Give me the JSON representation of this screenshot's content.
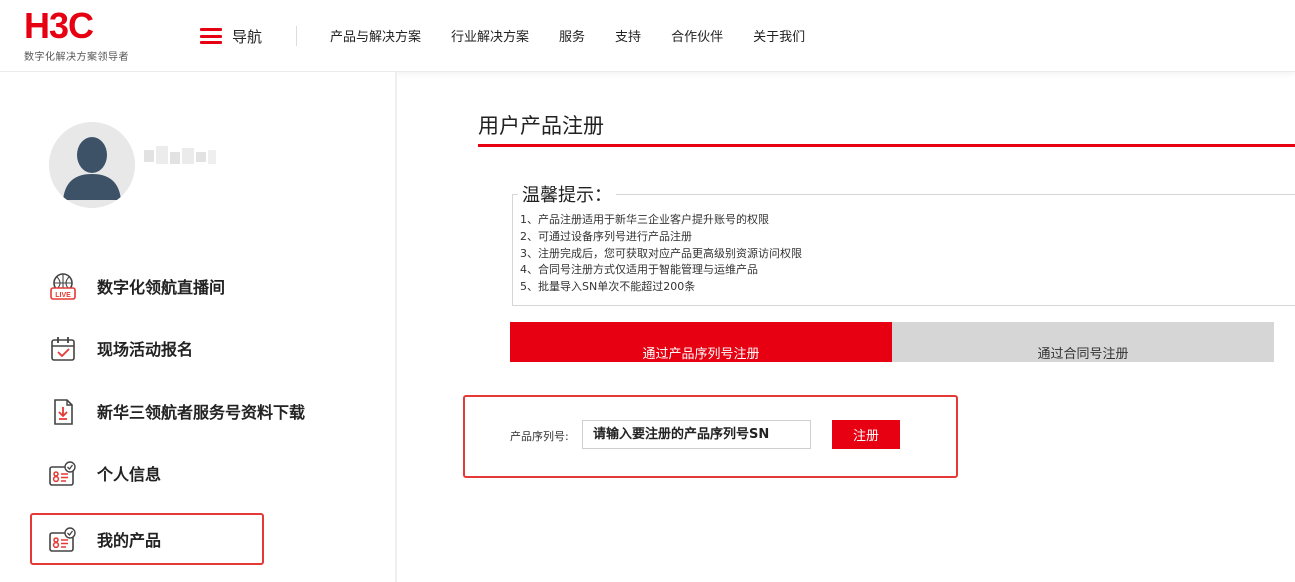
{
  "header": {
    "logo_text": "H3C",
    "logo_tagline": "数字化解决方案领导者",
    "nav_toggle_label": "导航",
    "nav_items": [
      "产品与解决方案",
      "行业解决方案",
      "服务",
      "支持",
      "合作伙伴",
      "关于我们"
    ]
  },
  "sidebar": {
    "menu": [
      {
        "label": "数字化领航直播间",
        "icon": "live-icon"
      },
      {
        "label": "现场活动报名",
        "icon": "calendar-icon"
      },
      {
        "label": "新华三领航者服务号资料下载",
        "icon": "download-doc-icon"
      },
      {
        "label": "个人信息",
        "icon": "id-card-icon"
      },
      {
        "label": "我的产品",
        "icon": "id-card-icon",
        "active": true
      }
    ]
  },
  "main": {
    "title": "用户产品注册",
    "notice": {
      "title": "温馨提示：",
      "items": [
        "1、产品注册适用于新华三企业客户提升账号的权限",
        "2、可通过设备序列号进行产品注册",
        "3、注册完成后，您可获取对应产品更高级别资源访问权限",
        "4、合同号注册方式仅适用于智能管理与运维产品",
        "5、批量导入SN单次不能超过200条"
      ]
    },
    "tabs": [
      {
        "label": "通过产品序列号注册",
        "active": true
      },
      {
        "label": "通过合同号注册",
        "active": false
      }
    ],
    "register": {
      "label": "产品序列号:",
      "placeholder": "请输入要注册的产品序列号SN",
      "button": "注册"
    }
  },
  "colors": {
    "brand_red": "#e60012",
    "tab_inactive_bg": "#d6d6d6",
    "highlight_border": "#e53935"
  }
}
